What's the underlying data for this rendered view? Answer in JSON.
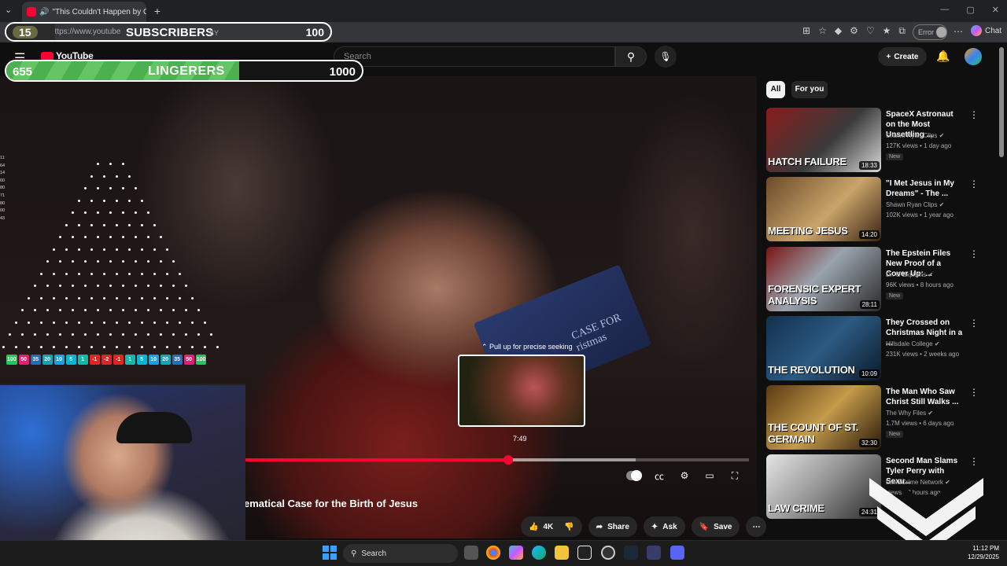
{
  "browser": {
    "tab_title": "\"This Couldn't Happen by Cha",
    "url": "https://www.youtube",
    "error_label": "Error",
    "chat_label": "Chat"
  },
  "overlay": {
    "subscribers": {
      "label": "SUBSCRIBERS",
      "current": "15",
      "goal": "100",
      "progress": 0.15,
      "covered_text": "BY"
    },
    "lingerers": {
      "label": "LINGERERS",
      "current": "655",
      "goal": "1000",
      "progress": 0.655
    },
    "plinko_side_numbers": [
      "11",
      "64",
      "14",
      "60",
      "80",
      "71",
      "80",
      "00",
      "43"
    ],
    "plinko_slots": [
      {
        "v": "100",
        "c": "#22c55e"
      },
      {
        "v": "50",
        "c": "#e11d74"
      },
      {
        "v": "35",
        "c": "#1e6fbf"
      },
      {
        "v": "20",
        "c": "#17a2b8"
      },
      {
        "v": "10",
        "c": "#0ea5e9"
      },
      {
        "v": "5",
        "c": "#06b6d4"
      },
      {
        "v": "1",
        "c": "#14b8a6"
      },
      {
        "v": "-1",
        "c": "#dc2626"
      },
      {
        "v": "-2",
        "c": "#dc2626"
      },
      {
        "v": "-1",
        "c": "#dc2626"
      },
      {
        "v": "1",
        "c": "#14b8a6"
      },
      {
        "v": "5",
        "c": "#06b6d4"
      },
      {
        "v": "10",
        "c": "#0ea5e9"
      },
      {
        "v": "20",
        "c": "#17a2b8"
      },
      {
        "v": "35",
        "c": "#1e6fbf"
      },
      {
        "v": "50",
        "c": "#e11d74"
      },
      {
        "v": "100",
        "c": "#22c55e"
      }
    ]
  },
  "youtube": {
    "logo_text": "YouTube",
    "search_placeholder": "Search",
    "create_label": "Create",
    "icons": {
      "menu": "hamburger-icon",
      "search": "search-icon",
      "mic": "mic-icon",
      "bell": "bell-icon"
    }
  },
  "player": {
    "seek_hint": "⌃ Pull up for precise seeking",
    "seek_time": "7:49",
    "played_fraction": 0.53,
    "book_text": "CASE FOR\nristmas",
    "title": "ematical Case for the Birth of Jesus",
    "likes": "4K",
    "share_label": "Share",
    "ask_label": "Ask",
    "save_label": "Save",
    "accent": "#ff0033"
  },
  "sidebar": {
    "chips": [
      "All",
      "For you"
    ],
    "videos": [
      {
        "title": "SpaceX Astronaut on the Most Unsettling ...",
        "channel": "Shawn Ryan Clips",
        "meta": "127K views • 1 day ago",
        "badge": "New",
        "duration": "18:33",
        "thumb_text": "HATCH FAILURE",
        "bg": "linear-gradient(135deg,#8a1b1b,#3a3a3a 55%,#d9d9d9)"
      },
      {
        "title": "\"I Met Jesus in My Dreams\" - The ...",
        "channel": "Shawn Ryan Clips",
        "meta": "102K views • 1 year ago",
        "badge": "",
        "duration": "14:20",
        "thumb_text": "MEETING JESUS",
        "bg": "linear-gradient(135deg,#6b4a2a,#c9a46a 55%,#3a2414)"
      },
      {
        "title": "The Epstein Files New Proof of a Cover Up: ...",
        "channel": "Dr. G Explains",
        "meta": "96K views • 8 hours ago",
        "badge": "New",
        "duration": "28:11",
        "thumb_text": "FORENSIC EXPERT ANALYSIS",
        "bg": "linear-gradient(135deg,#7a1414,#9aa3ad 45%,#2a2a2a)"
      },
      {
        "title": "They Crossed on Christmas Night in a ...",
        "channel": "Hillsdale College",
        "meta": "231K views • 2 weeks ago",
        "badge": "",
        "duration": "10:09",
        "thumb_text": "THE REVOLUTION",
        "bg": "linear-gradient(135deg,#12304e,#2c5a82 50%,#0b1a2a)"
      },
      {
        "title": "The Man Who Saw Christ Still Walks ...",
        "channel": "The Why Files",
        "meta": "1.7M views • 6 days ago",
        "badge": "New",
        "duration": "32:30",
        "thumb_text": "THE COUNT OF ST. GERMAIN",
        "bg": "linear-gradient(135deg,#5a3a12,#c49a4a 50%,#2a1a0a)"
      },
      {
        "title": "Second Man Slams Tyler Perry with Sexu...",
        "channel": "Law&Crime Network",
        "meta": "views • 8 hours ago",
        "badge": "",
        "duration": "24:31",
        "thumb_text": "LAW CRIME",
        "bg": "linear-gradient(135deg,#e5e5e5,#9a9a9a 45%,#2a2a2a)"
      }
    ]
  },
  "taskbar": {
    "search_label": "Search",
    "time": "11:12 PM",
    "date": "12/29/2025"
  }
}
